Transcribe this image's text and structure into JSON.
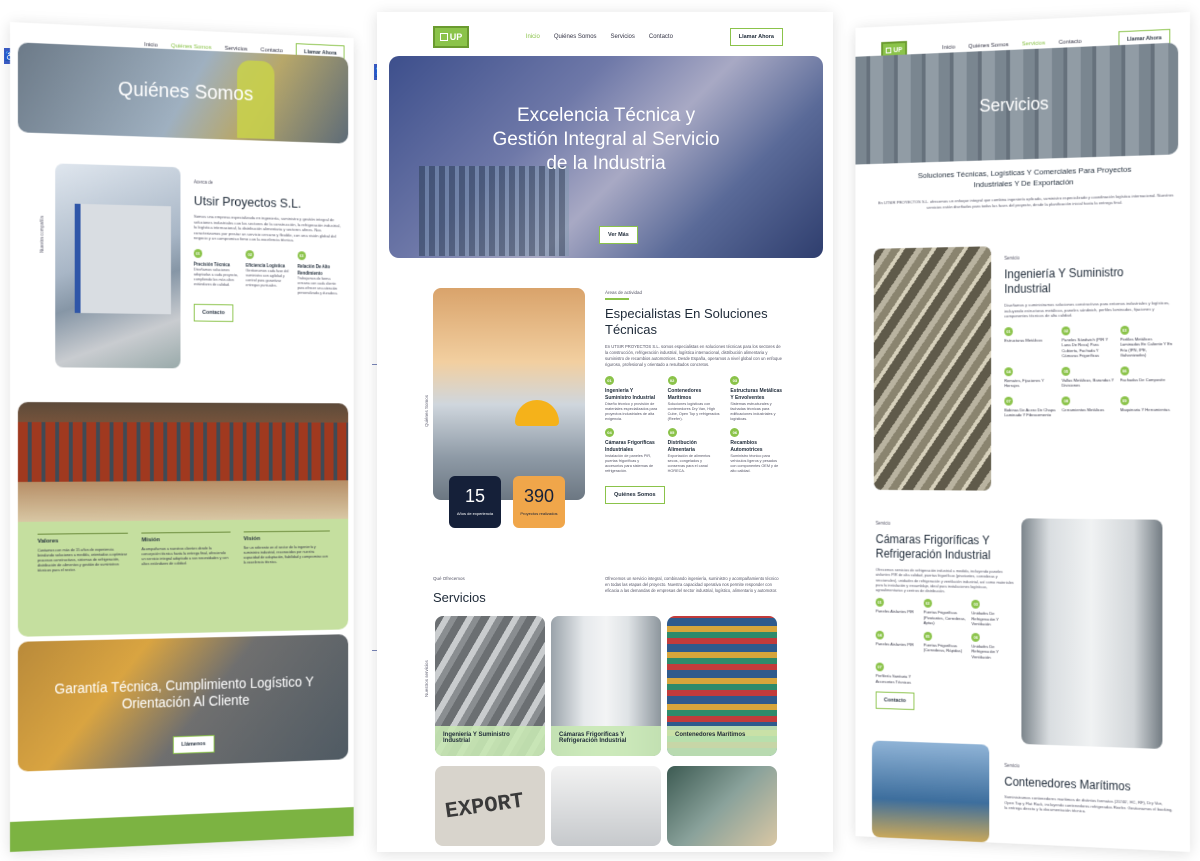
{
  "nav": {
    "logo": "UP",
    "inicio": "Inicio",
    "quienes": "Quiénes Somos",
    "servicios": "Servicios",
    "contacto": "Contacto",
    "cta": "Llamar Ahora"
  },
  "left": {
    "hero_title": "Quiénes Somos",
    "vertical_label": "Nuestra compañía",
    "about_tag": "Acerca de",
    "about_title": "Utsir Proyectos S.L.",
    "about_text": "Somos una empresa especializada en ingeniería, suministro y gestión integral de soluciones industriales con los sectores de la construcción, la refrigeración industrial, la logística internacional, la distribución alimentaria y sectores afines. Nos caracterizamos por prestar un servicio cercano y flexible, con una visión global del negocio y un compromiso firme con la excelencia técnica.",
    "features": [
      {
        "n": "01",
        "title": "Precisión Técnica",
        "text": "Diseñamos soluciones adaptadas a cada proyecto, cumpliendo los más altos estándares de calidad."
      },
      {
        "n": "02",
        "title": "Eficiencia Logística",
        "text": "Gestionamos cada fase del suministro con agilidad y control para garantizar entregas puntuales."
      },
      {
        "n": "03",
        "title": "Relación De Alto Rendimiento",
        "text": "Trabajamos de forma cercana con cada cliente para ofrecer una atención personalizada y duradera."
      }
    ],
    "contact_btn": "Contacto",
    "values": [
      {
        "title": "Valores",
        "text": "Contamos con más de 15 años de experiencia brindando soluciones a medida, orientadas a optimizar procesos constructivos, sistemas de refrigeración, distribución de alimentos y gestión de suministros técnicos para el sector."
      },
      {
        "title": "Misión",
        "text": "Acompañamos a nuestros clientes desde la concepción técnica hasta la entrega final, ofreciendo un servicio integral adaptado a sus necesidades y con altos estándares de calidad."
      },
      {
        "title": "Visión",
        "text": "Ser un referente en el sector de la ingeniería y suministro industrial, reconocidos por nuestra capacidad de adaptación, fiabilidad y compromiso con la excelencia técnica."
      }
    ],
    "bottom_title": "Garantía Técnica, Cumplimiento Logístico Y Orientación Al Cliente",
    "bottom_btn": "Llámenos"
  },
  "center": {
    "hero_title": "Excelencia Técnica y Gestión Integral al Servicio de la Industria",
    "hero_btn": "Ver Más",
    "vertical_label": "Quiénes Somos",
    "area_tag": "Áreas de actividad",
    "title": "Especialistas En Soluciones Técnicas",
    "text": "En UTSIR PROYECTOS S.L. somos especialistas en soluciones técnicas para los sectores de la construcción, refrigeración industrial, logística internacional, distribución alimentaria y suministro de recambios automotrices. Desde España, operamos a nivel global con un enfoque riguroso, profesional y orientado a resultados concretos.",
    "stats": [
      {
        "value": "15",
        "label": "Años de experiencia"
      },
      {
        "value": "390",
        "label": "Proyectos realizados"
      }
    ],
    "services": [
      {
        "n": "01",
        "title": "Ingeniería Y Suministro Industrial",
        "text": "Diseño técnico y provisión de materiales especializados para proyectos industriales de alta exigencia."
      },
      {
        "n": "02",
        "title": "Contenedores Marítimos",
        "text": "Soluciones logísticas con contenedores Dry Van, High Cube, Open Top y refrigerados (Reefer)."
      },
      {
        "n": "03",
        "title": "Estructuras Metálicas Y Envolventes",
        "text": "Sistemas estructurales y fachadas técnicas para edificaciones industriales y logísticas."
      },
      {
        "n": "04",
        "title": "Cámaras Frigoríficas Industriales",
        "text": "Instalación de paneles PIR, puertas frigoríficas y accesorios para sistemas de refrigeración."
      },
      {
        "n": "05",
        "title": "Distribución Alimentaria",
        "text": "Exportación de alimentos secos, congelados y conservas para el canal HORECA."
      },
      {
        "n": "06",
        "title": "Recambios Automotrices",
        "text": "Suministro técnico para vehículos ligeros y pesados con componentes OEM y de alto calidad."
      }
    ],
    "about_btn": "Quiénes Somos",
    "offer_tag": "Qué Ofrecemos",
    "offer_title": "Servicios",
    "offer_text": "Ofrecemos un servicio integral, combinando ingeniería, suministro y acompañamiento técnico en todas las etapas del proyecto. Nuestra capacidad operativa nos permite responder con eficacia a las demandas de empresas del sector industrial, logístico, alimentario y automotor.",
    "vertical_label2": "Nuestros servicios",
    "cards": [
      "Ingeniería Y Suministro Industrial",
      "Cámaras Frigoríficas Y Refrigeración Industrial",
      "Contenedores Marítimos"
    ],
    "export_word": "EXPORT"
  },
  "right": {
    "hero_title": "Servicios",
    "subtitle": "Soluciones Técnicas, Logísticas Y Comerciales Para Proyectos Industriales Y De Exportación",
    "intro": "En UTSIR PROYECTOS S.L. ofrecemos un enfoque integral que combina ingeniería aplicada, suministro especializado y coordinación logística internacional. Nuestros servicios están diseñados para todas las fases del proyecto, desde la planificación inicial hasta la entrega final.",
    "s1_tag": "Servicio",
    "s1_title": "Ingeniería Y Suministro Industrial",
    "s1_text": "Diseñamos y suministramos soluciones constructivas para entornos industriales y logísticos, incluyendo estructuras metálicas, paneles sándwich, perfiles laminados, fijaciones y componentes técnicos de alta calidad.",
    "s1_items": [
      {
        "n": "01",
        "t": "Estructuras Metálicas"
      },
      {
        "n": "02",
        "t": "Paneles Sándwich (PIR Y Lana De Roca) Para Cubierta, Fachada Y Cámaras Frigoríficas"
      },
      {
        "n": "03",
        "t": "Perfiles Metálicos Laminados En Caliente Y En Frío (IPN, IPE, Galvanizados)"
      },
      {
        "n": "04",
        "t": "Remates, Fijaciones Y Herrajes"
      },
      {
        "n": "05",
        "t": "Vallas Metálicas, Barandas Y Divisiones"
      },
      {
        "n": "06",
        "t": "Fachadas De Composite"
      },
      {
        "n": "07",
        "t": "Bobinas De Acero De Chapa Laminado Y Fibrocemento"
      },
      {
        "n": "08",
        "t": "Cerramientos Metálicos"
      },
      {
        "n": "09",
        "t": "Maquinaria Y Herramientas"
      }
    ],
    "s2_tag": "Servicio",
    "s2_title": "Cámaras Frigoríficas Y Refrigeración Industrial",
    "s2_text": "Ofrecemos servicios de refrigeración industrial a medida, incluyendo paneles aislantes PIR de alta calidad, puertas frigoríficas (pivotantes, correderas y seccionales), unidades de refrigeración y ventilación industrial, así como materiales para la instalación y ensamblaje, ideal para instalaciones logísticas, agroalimentarias y centros de distribución.",
    "s2_items": [
      {
        "n": "01",
        "t": "Paneles Aislantes PIR"
      },
      {
        "n": "02",
        "t": "Puertas Frigoríficas (Pivotantes, Correderas, Aptas)"
      },
      {
        "n": "03",
        "t": "Unidades De Refrigeración Y Ventilación"
      },
      {
        "n": "04",
        "t": "Paneles Aislantes PIR"
      },
      {
        "n": "05",
        "t": "Puertas Frigoríficas (Correderas, Rápidas)"
      },
      {
        "n": "06",
        "t": "Unidades De Refrigeración Y Ventilación"
      },
      {
        "n": "07",
        "t": "Perfilería Sanitaria Y Accesorios Técnicos"
      }
    ],
    "s2_btn": "Contacto",
    "s3_tag": "Servicio",
    "s3_title": "Contenedores Marítimos",
    "s3_text": "Suministramos contenedores marítimos de distintos formatos (20'/40', HC, RF), Dry Van, Open Top y Flat Rack, incluyendo contenedores refrigerados Reefer. Gestionamos el booking, la entrega directa y la documentación técnica."
  }
}
